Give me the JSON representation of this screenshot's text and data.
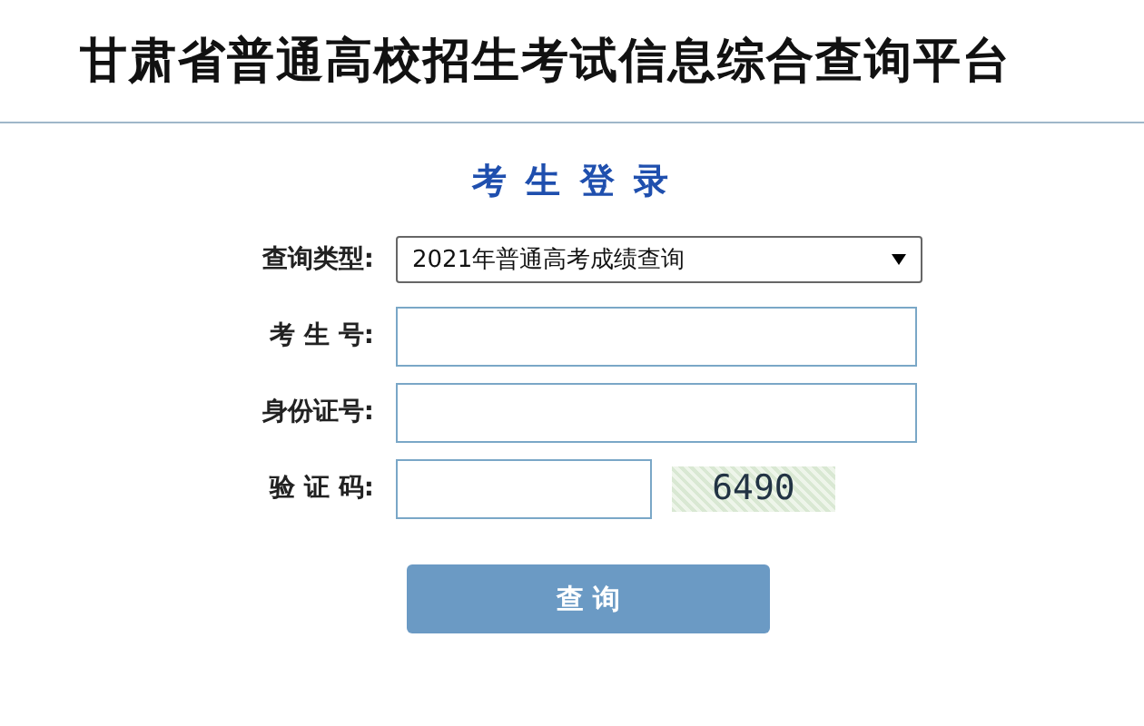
{
  "header": {
    "title": "甘肃省普通高校招生考试信息综合查询平台"
  },
  "form": {
    "heading": "考 生 登 录",
    "fields": [
      {
        "kind": "select",
        "label": "查询类型:",
        "value": "2021年普通高考成绩查询"
      },
      {
        "kind": "text",
        "label": "考 生 号:"
      },
      {
        "kind": "text",
        "label": "身份证号:"
      },
      {
        "kind": "captcha",
        "label": "验 证 码:",
        "captcha": "6490"
      }
    ],
    "submit": "查 询"
  }
}
